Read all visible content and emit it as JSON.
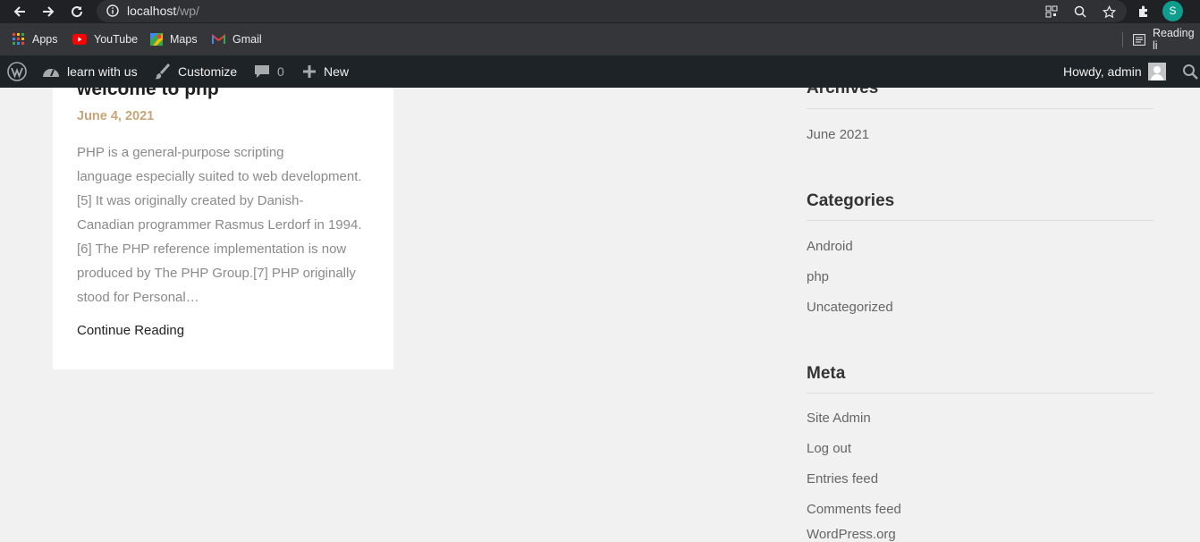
{
  "browser": {
    "url_host": "localhost",
    "url_path": "/wp/",
    "profile_initial": "S"
  },
  "bookmarks": [
    {
      "label": "Apps",
      "icon": "apps-grid-icon"
    },
    {
      "label": "YouTube",
      "icon": "youtube-icon"
    },
    {
      "label": "Maps",
      "icon": "maps-icon"
    },
    {
      "label": "Gmail",
      "icon": "gmail-icon"
    }
  ],
  "reading_list": "Reading li",
  "adminbar": {
    "site_name": "learn with us",
    "customize": "Customize",
    "comments_count": "0",
    "new": "New",
    "howdy": "Howdy, admin"
  },
  "post": {
    "title": "welcome to php",
    "date": "June 4, 2021",
    "excerpt_lines": [
      "PHP is a general-purpose scripting",
      "language especially suited to web development.",
      "[5] It was originally created by Danish-",
      "Canadian programmer Rasmus Lerdorf in 1994.",
      "[6] The PHP reference implementation is now",
      "produced by The PHP Group.[7] PHP originally",
      "stood for Personal…"
    ],
    "continue": "Continue Reading"
  },
  "sidebar": {
    "archives_title": "Archives",
    "archives": [
      "June 2021"
    ],
    "categories_title": "Categories",
    "categories": [
      "Android",
      "php",
      "Uncategorized"
    ],
    "meta_title": "Meta",
    "meta": [
      "Site Admin",
      "Log out",
      "Entries feed",
      "Comments feed",
      "WordPress.org"
    ]
  }
}
